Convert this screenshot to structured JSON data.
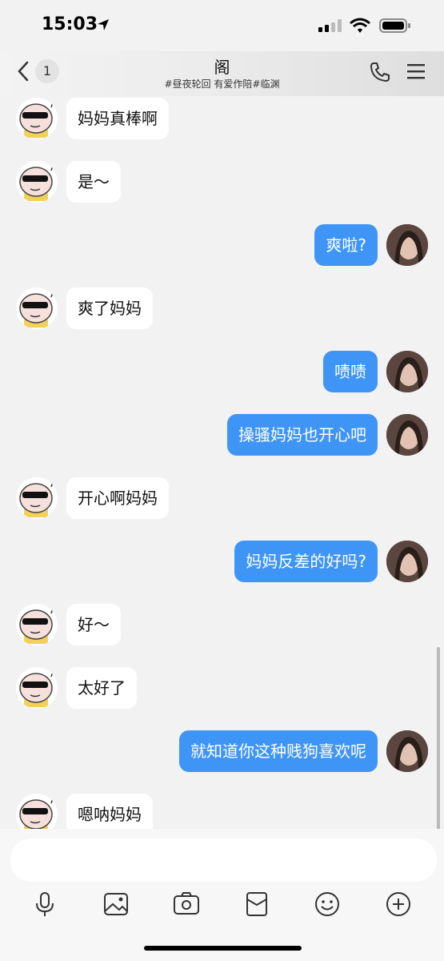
{
  "status": {
    "time": "15:03",
    "icons": [
      "location-arrow-icon",
      "cellular-signal-icon",
      "wifi-icon",
      "battery-icon"
    ]
  },
  "header": {
    "unread_count": "1",
    "title": "阁",
    "subtitle": "#昼夜轮回 有爱作陪#临渊",
    "icons": [
      "back-chevron-icon",
      "phone-icon",
      "menu-icon"
    ]
  },
  "messages": [
    {
      "side": "left",
      "text": "妈妈真棒啊"
    },
    {
      "side": "left",
      "text": "是～"
    },
    {
      "side": "right",
      "text": "爽啦?"
    },
    {
      "side": "left",
      "text": "爽了妈妈"
    },
    {
      "side": "right",
      "text": "啧啧"
    },
    {
      "side": "right",
      "text": "操骚妈妈也开心吧"
    },
    {
      "side": "left",
      "text": "开心啊妈妈"
    },
    {
      "side": "right",
      "text": "妈妈反差的好吗?"
    },
    {
      "side": "left",
      "text": "好～"
    },
    {
      "side": "left",
      "text": "太好了"
    },
    {
      "side": "right",
      "text": "就知道你这种贱狗喜欢呢"
    },
    {
      "side": "left",
      "text": "嗯呐妈妈"
    }
  ],
  "composer": {
    "placeholder": "",
    "tools": [
      "microphone-icon",
      "image-icon",
      "camera-icon",
      "red-envelope-icon",
      "emoji-icon",
      "plus-icon"
    ]
  },
  "colors": {
    "outgoing_bubble": "#3f95f5",
    "incoming_bubble": "#ffffff",
    "background": "#f2f2f2"
  }
}
